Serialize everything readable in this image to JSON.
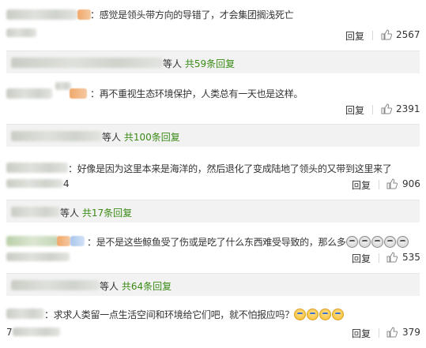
{
  "comments": [
    {
      "text": "：感觉是领头带方向的导错了，才会集团搁浅死亡",
      "reply": "回复",
      "likes": "2567"
    },
    {
      "text": "：再不重视生态环境保护，人类总有一天也是这样。",
      "reply": "回复",
      "likes": "2391"
    },
    {
      "text": "：好像是因为这里本来是海洋的，然后退化了变成陆地了领头的又带到这里来了",
      "date_fragment": "4",
      "reply": "回复",
      "likes": "906"
    },
    {
      "text": "：是不是这些鲸鱼受了伤或是吃了什么东西难受导致的，那么多",
      "reply": "回复",
      "likes": "535"
    },
    {
      "text": "：求求人类留一点生活空间和环境给它们吧，就不怕报应吗？",
      "date_fragment": "7",
      "reply": "回复",
      "likes": "379"
    }
  ],
  "subreplies": [
    {
      "suffix": "等人 ",
      "count": "共59条回复"
    },
    {
      "suffix": "等人 ",
      "count": "共100条回复"
    },
    {
      "suffix": "等人 ",
      "count": "共17条回复"
    },
    {
      "suffix": "等人 ",
      "count": "共64条回复"
    }
  ],
  "colors": {
    "accent_green": "#3a8a16",
    "subreply_bg": "#f2f2f2",
    "text": "#333333"
  },
  "icons": {
    "thumb": "thumbs-up-icon"
  }
}
